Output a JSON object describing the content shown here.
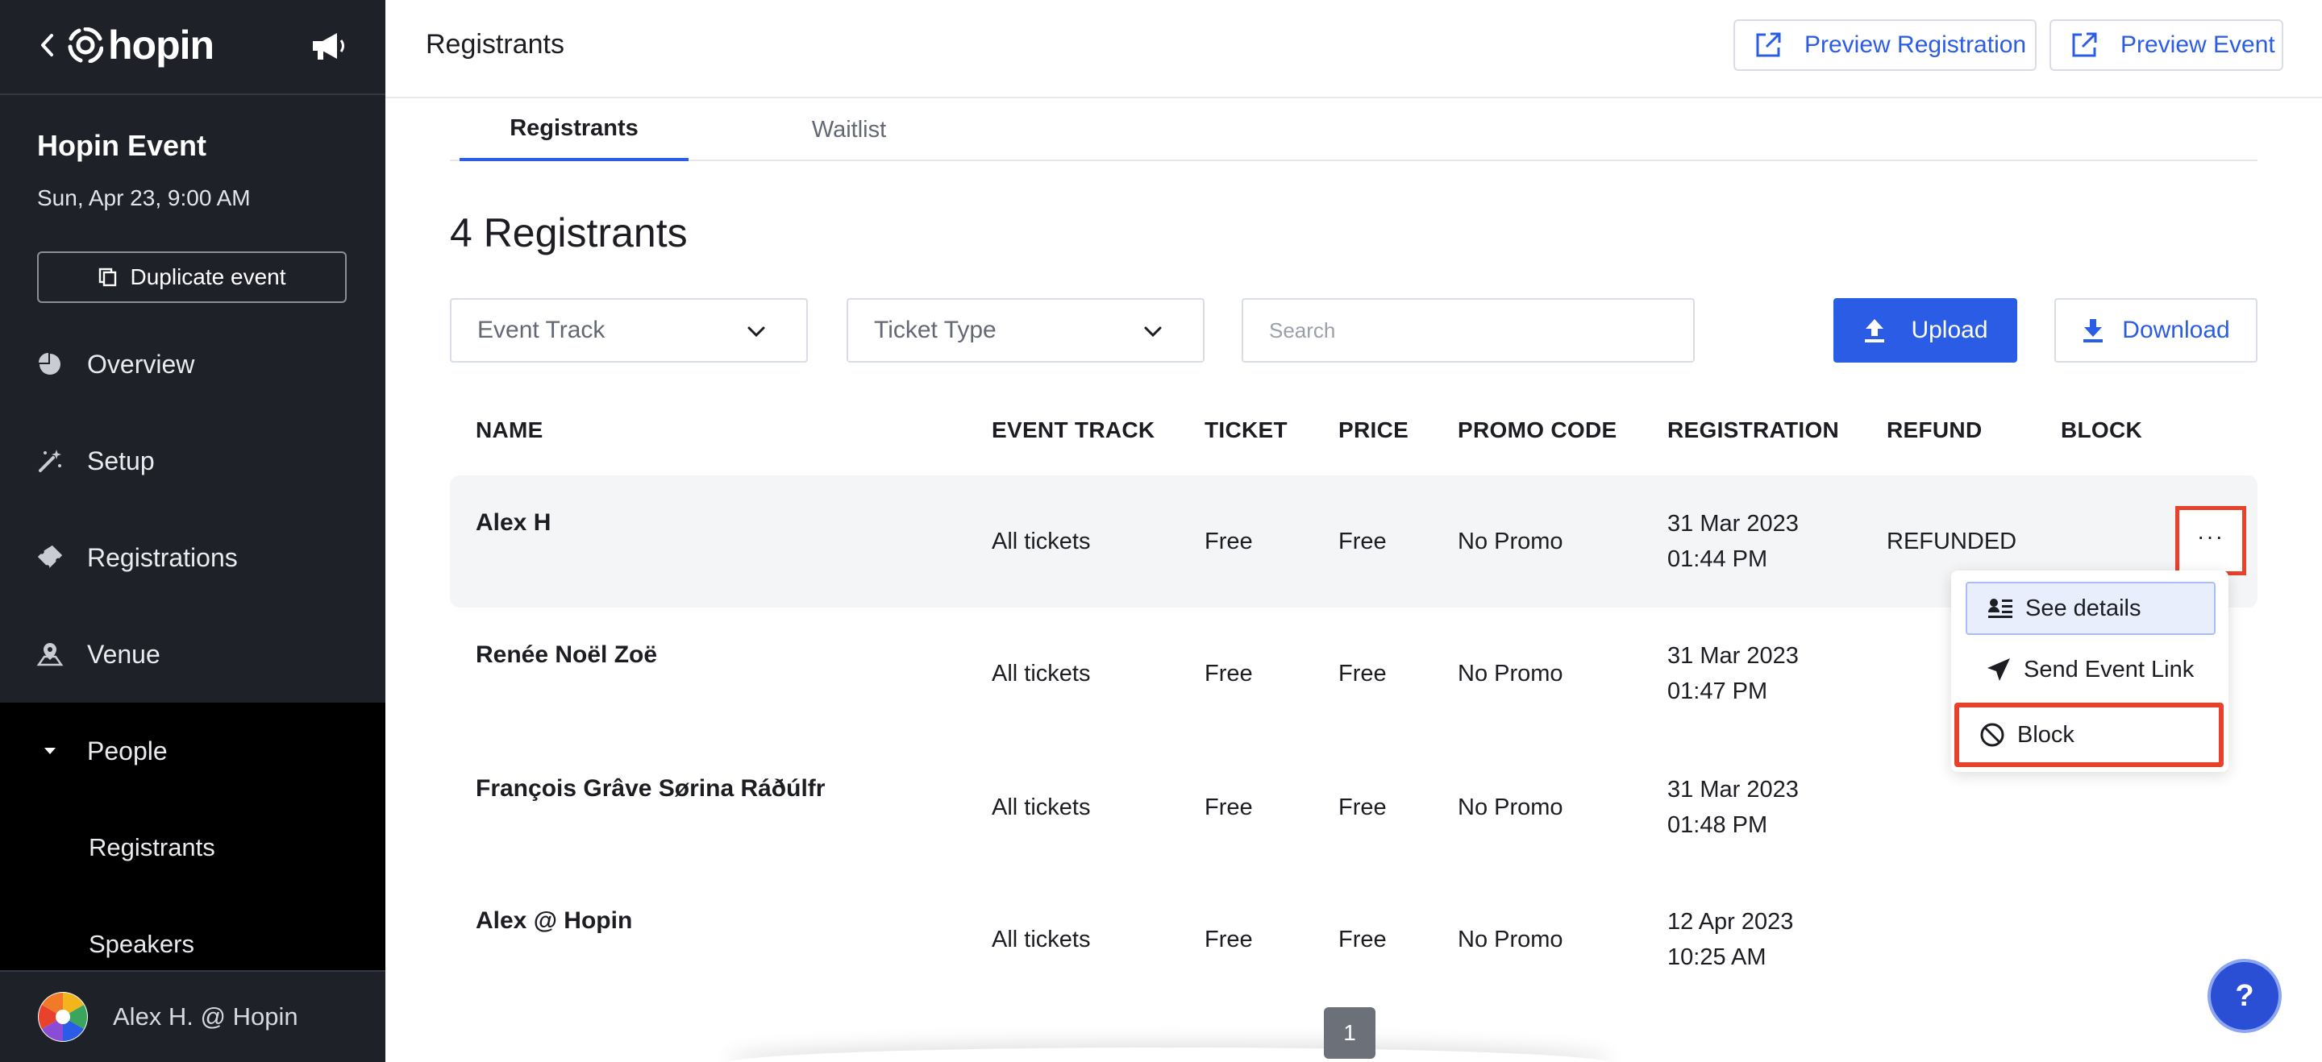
{
  "brand": {
    "name": "hopin"
  },
  "sidebar": {
    "event_name": "Hopin Event",
    "event_date": "Sun, Apr 23, 9:00 AM",
    "duplicate_label": "Duplicate event",
    "nav": [
      {
        "label": "Overview",
        "icon": "pie-chart-icon"
      },
      {
        "label": "Setup",
        "icon": "magic-wand-icon"
      },
      {
        "label": "Registrations",
        "icon": "ticket-icon"
      },
      {
        "label": "Venue",
        "icon": "map-pin-icon"
      },
      {
        "label": "People",
        "icon": "caret-down-icon"
      }
    ],
    "people_sub": [
      "Registrants",
      "Speakers"
    ],
    "user_name": "Alex H. @ Hopin"
  },
  "header": {
    "title": "Registrants",
    "preview_registration": "Preview Registration",
    "preview_event": "Preview Event"
  },
  "tabs": [
    "Registrants",
    "Waitlist"
  ],
  "count_label": "4 Registrants",
  "filters": {
    "event_track": "Event Track",
    "ticket_type": "Ticket Type",
    "search_placeholder": "Search",
    "upload": "Upload",
    "download": "Download"
  },
  "table": {
    "columns": [
      "NAME",
      "EVENT TRACK",
      "TICKET",
      "PRICE",
      "PROMO CODE",
      "REGISTRATION",
      "REFUND",
      "BLOCK"
    ],
    "rows": [
      {
        "name": "Alex H",
        "track": "All tickets",
        "ticket": "Free",
        "price": "Free",
        "promo": "No Promo",
        "reg_date": "31 Mar 2023",
        "reg_time": "01:44 PM",
        "refund": "REFUNDED"
      },
      {
        "name": "Renée Noël Zoë",
        "track": "All tickets",
        "ticket": "Free",
        "price": "Free",
        "promo": "No Promo",
        "reg_date": "31 Mar 2023",
        "reg_time": "01:47 PM",
        "refund": ""
      },
      {
        "name": "François Grâve Sørina Ráðúlfr",
        "track": "All tickets",
        "ticket": "Free",
        "price": "Free",
        "promo": "No Promo",
        "reg_date": "31 Mar 2023",
        "reg_time": "01:48 PM",
        "refund": ""
      },
      {
        "name": "Alex @ Hopin",
        "track": "All tickets",
        "ticket": "Free",
        "price": "Free",
        "promo": "No Promo",
        "reg_date": "12 Apr 2023",
        "reg_time": "10:25 AM",
        "refund": ""
      }
    ]
  },
  "row_menu": {
    "more": "···",
    "items": [
      "See details",
      "Send Event Link",
      "Block"
    ]
  },
  "pagination": {
    "current": "1"
  },
  "help": "?",
  "colors": {
    "accent": "#2b5ce6",
    "sidebar_bg": "#1e2128",
    "highlight": "#e8412c"
  }
}
